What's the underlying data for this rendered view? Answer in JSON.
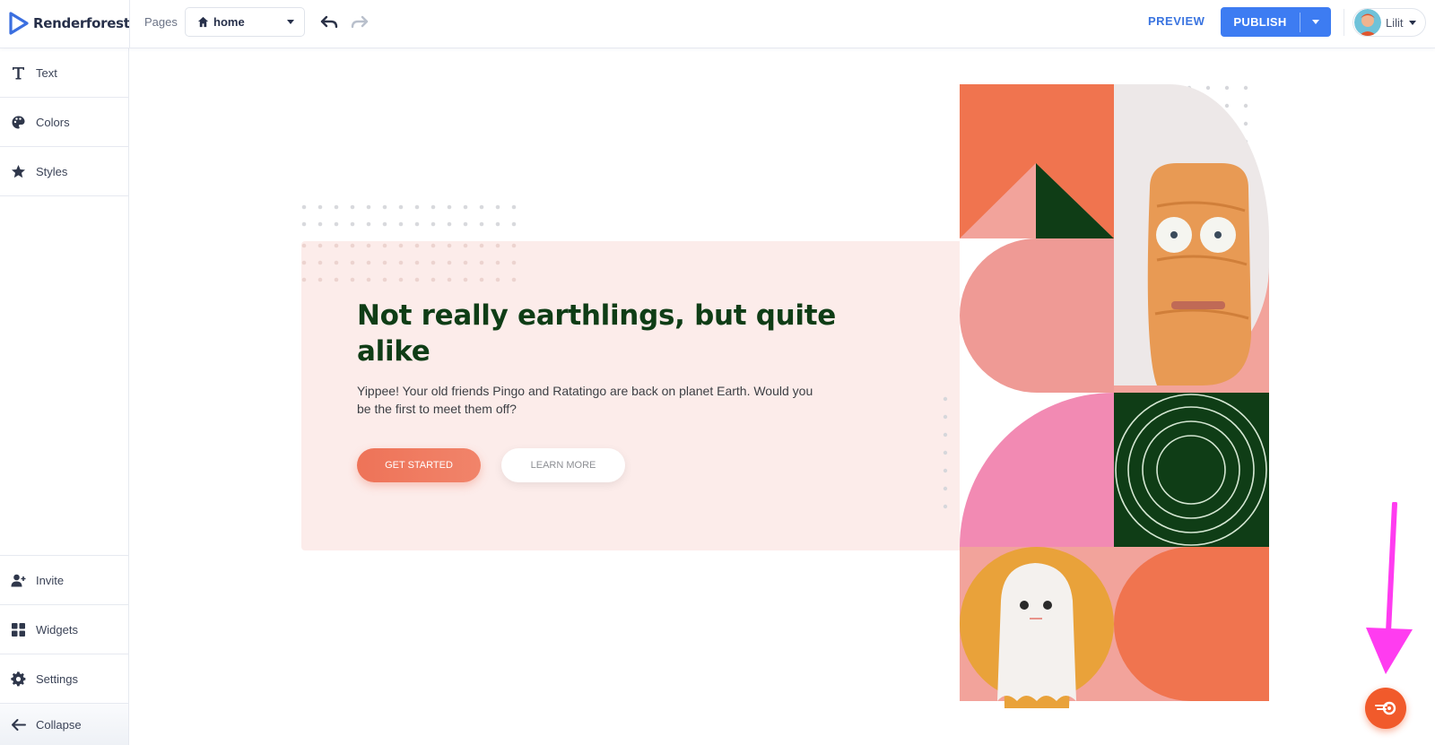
{
  "app": {
    "brand": "Renderforest"
  },
  "toolbar": {
    "pages_label": "Pages",
    "page_select_value": "home",
    "preview_label": "PREVIEW",
    "publish_label": "PUBLISH",
    "user_name": "Lilit"
  },
  "sidebar": {
    "items": [
      {
        "label": "Text",
        "icon": "text-icon"
      },
      {
        "label": "Colors",
        "icon": "palette-icon"
      },
      {
        "label": "Styles",
        "icon": "star-icon"
      }
    ],
    "bottom_items": [
      {
        "label": "Invite",
        "icon": "add-user-icon"
      },
      {
        "label": "Widgets",
        "icon": "widgets-icon"
      },
      {
        "label": "Settings",
        "icon": "gear-icon"
      },
      {
        "label": "Collapse",
        "icon": "arrow-left-icon"
      }
    ]
  },
  "canvas": {
    "headline": "Not really earthlings, but quite alike",
    "subtext": "Yippee! Your old friends Pingo and Ratatingo are back on planet Earth. Would you be the first to meet them off?",
    "primary_button": "GET STARTED",
    "secondary_button": "LEARN MORE"
  },
  "colors": {
    "accent": "#3d7cf2",
    "headline": "#0f3d16",
    "coral": "#f0744f",
    "pink": "#f28ab3",
    "dark_green": "#0f3d16",
    "annotation": "#ff3cf0"
  }
}
